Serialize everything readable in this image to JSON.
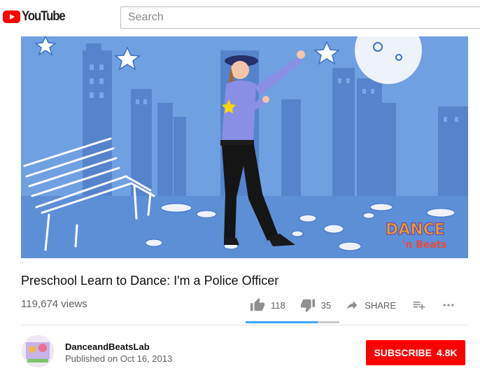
{
  "header": {
    "logo_text": "YouTube",
    "search_placeholder": "Search"
  },
  "player": {
    "watermark_line1": "DANCE",
    "watermark_line2": "'n Beats"
  },
  "video": {
    "title": "Preschool Learn to Dance: I'm a Police Officer",
    "views": "119,674 views",
    "likes": "118",
    "dislikes": "35",
    "share_label": "SHARE",
    "like_ratio": 0.77
  },
  "channel": {
    "name": "DanceandBeatsLab",
    "published": "Published on Oct 16, 2013",
    "subscribe_label": "SUBSCRIBE",
    "subscriber_count": "4.8K"
  },
  "colors": {
    "brand_red": "#ff0000",
    "sentiment_blue": "#3ea6ff",
    "player_sky": "#6f9fe0"
  },
  "icons": [
    "youtube-logo-icon",
    "thumbs-up-icon",
    "thumbs-down-icon",
    "share-icon",
    "add-to-playlist-icon",
    "more-icon"
  ]
}
